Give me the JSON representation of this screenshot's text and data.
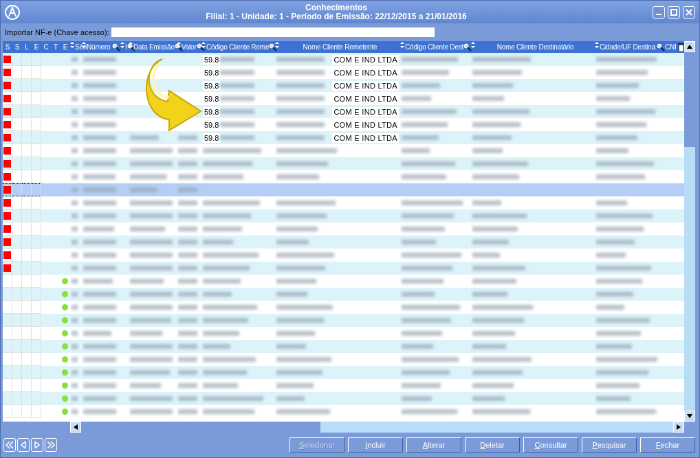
{
  "window": {
    "title": "Conhecimentos",
    "subtitle": "Filial: 1 - Unidade: 1 - Período de Emissão: 22/12/2015 a 21/01/2016"
  },
  "import_field": {
    "label": "Importar NF-e (Chave acesso):"
  },
  "table": {
    "columns": [
      "S",
      "S",
      "L",
      "E",
      "C",
      "T",
      "E",
      "Séri",
      "Número",
      "I",
      "Data Emissão",
      "Valor",
      "Código Cliente Reme",
      "Nome Cliente Remetente",
      "Código Cliente Dest",
      "Nome Cliente Destinatário",
      "Cidade/UF Destina",
      "CNI"
    ],
    "rows": [
      {
        "status": {
          "kind": "square",
          "color": "#ff0000"
        },
        "codigo_remetente": "59.8",
        "nome_remetente": "COM E IND LTDA",
        "selected": false
      },
      {
        "status": {
          "kind": "square",
          "color": "#ff0000"
        },
        "codigo_remetente": "59.8",
        "nome_remetente": "COM E IND LTDA",
        "selected": false
      },
      {
        "status": {
          "kind": "square",
          "color": "#ff0000"
        },
        "codigo_remetente": "59.8",
        "nome_remetente": "COM E IND LTDA",
        "selected": false
      },
      {
        "status": {
          "kind": "square",
          "color": "#ff0000"
        },
        "codigo_remetente": "59.8",
        "nome_remetente": "COM E IND LTDA",
        "selected": false
      },
      {
        "status": {
          "kind": "square",
          "color": "#ff0000"
        },
        "codigo_remetente": "59.8",
        "nome_remetente": "COM E IND LTDA",
        "selected": false
      },
      {
        "status": {
          "kind": "square",
          "color": "#ff0000"
        },
        "codigo_remetente": "59.8",
        "nome_remetente": "COM E IND LTDA",
        "selected": false
      },
      {
        "status": {
          "kind": "square",
          "color": "#ff0000"
        },
        "codigo_remetente": "59.8",
        "nome_remetente": "COM E IND LTDA",
        "selected": false
      },
      {
        "status": {
          "kind": "square",
          "color": "#ff0000"
        },
        "selected": false
      },
      {
        "status": {
          "kind": "square",
          "color": "#ff0000"
        },
        "selected": false
      },
      {
        "status": {
          "kind": "square",
          "color": "#ff0000"
        },
        "selected": false
      },
      {
        "status": {
          "kind": "square",
          "color": "#ff0000"
        },
        "selected": true
      },
      {
        "status": {
          "kind": "square",
          "color": "#ff0000"
        },
        "selected": false
      },
      {
        "status": {
          "kind": "square",
          "color": "#ff0000"
        },
        "selected": false
      },
      {
        "status": {
          "kind": "square",
          "color": "#ff0000"
        },
        "selected": false
      },
      {
        "status": {
          "kind": "square",
          "color": "#ff0000"
        },
        "selected": false
      },
      {
        "status": {
          "kind": "square",
          "color": "#ff0000"
        },
        "selected": false
      },
      {
        "status": {
          "kind": "square",
          "color": "#ff0000"
        },
        "selected": false
      },
      {
        "status": {
          "kind": "dot",
          "color": "#88e040"
        },
        "selected": false
      },
      {
        "status": {
          "kind": "dot",
          "color": "#88e040"
        },
        "selected": false
      },
      {
        "status": {
          "kind": "dot",
          "color": "#88e040"
        },
        "selected": false
      },
      {
        "status": {
          "kind": "dot",
          "color": "#88e040"
        },
        "selected": false
      },
      {
        "status": {
          "kind": "dot",
          "color": "#88e040"
        },
        "selected": false
      },
      {
        "status": {
          "kind": "dot",
          "color": "#88e040"
        },
        "selected": false
      },
      {
        "status": {
          "kind": "dot",
          "color": "#88e040"
        },
        "selected": false
      },
      {
        "status": {
          "kind": "dot",
          "color": "#88e040"
        },
        "selected": false
      },
      {
        "status": {
          "kind": "dot",
          "color": "#88e040"
        },
        "selected": false
      },
      {
        "status": {
          "kind": "dot",
          "color": "#88e040"
        },
        "selected": false
      },
      {
        "status": {
          "kind": "dot",
          "color": "#88e040"
        },
        "selected": false
      }
    ]
  },
  "buttons": [
    {
      "label": "Selecionar",
      "disabled": true
    },
    {
      "label": "Incluir",
      "disabled": false
    },
    {
      "label": "Alterar",
      "disabled": false
    },
    {
      "label": "Deletar",
      "disabled": false
    },
    {
      "label": "Consultar",
      "disabled": false
    },
    {
      "label": "Pesquisar",
      "disabled": false
    },
    {
      "label": "Fechar",
      "disabled": false
    }
  ]
}
